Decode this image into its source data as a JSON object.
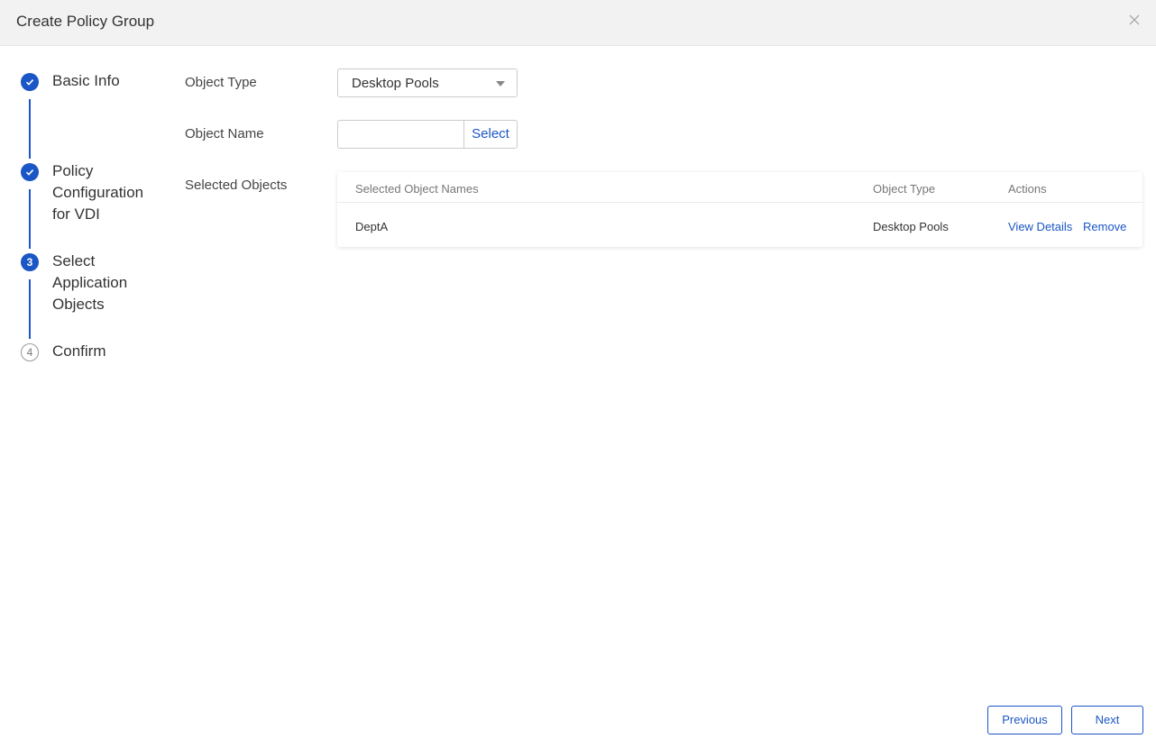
{
  "dialog": {
    "title": "Create Policy Group",
    "close_icon": "close-icon"
  },
  "stepper": {
    "steps": [
      {
        "label": "Basic Info",
        "state": "done",
        "icon": "check-icon"
      },
      {
        "label": "Policy Configuration for VDI",
        "state": "done",
        "icon": "check-icon"
      },
      {
        "label": "Select Application Objects",
        "state": "current",
        "number": "3"
      },
      {
        "label": "Confirm",
        "state": "pending",
        "number": "4"
      }
    ]
  },
  "form": {
    "object_type_label": "Object Type",
    "object_type_value": "Desktop Pools",
    "object_name_label": "Object Name",
    "object_name_value": "",
    "select_button": "Select",
    "selected_objects_label": "Selected Objects"
  },
  "table": {
    "columns": [
      "Selected Object Names",
      "Object Type",
      "Actions"
    ],
    "rows": [
      {
        "name": "DeptA",
        "type": "Desktop Pools",
        "actions": [
          "View Details",
          "Remove"
        ]
      }
    ]
  },
  "footer": {
    "previous": "Previous",
    "next": "Next"
  },
  "colors": {
    "accent": "#1a56c6",
    "header_bg": "#f2f2f2"
  }
}
